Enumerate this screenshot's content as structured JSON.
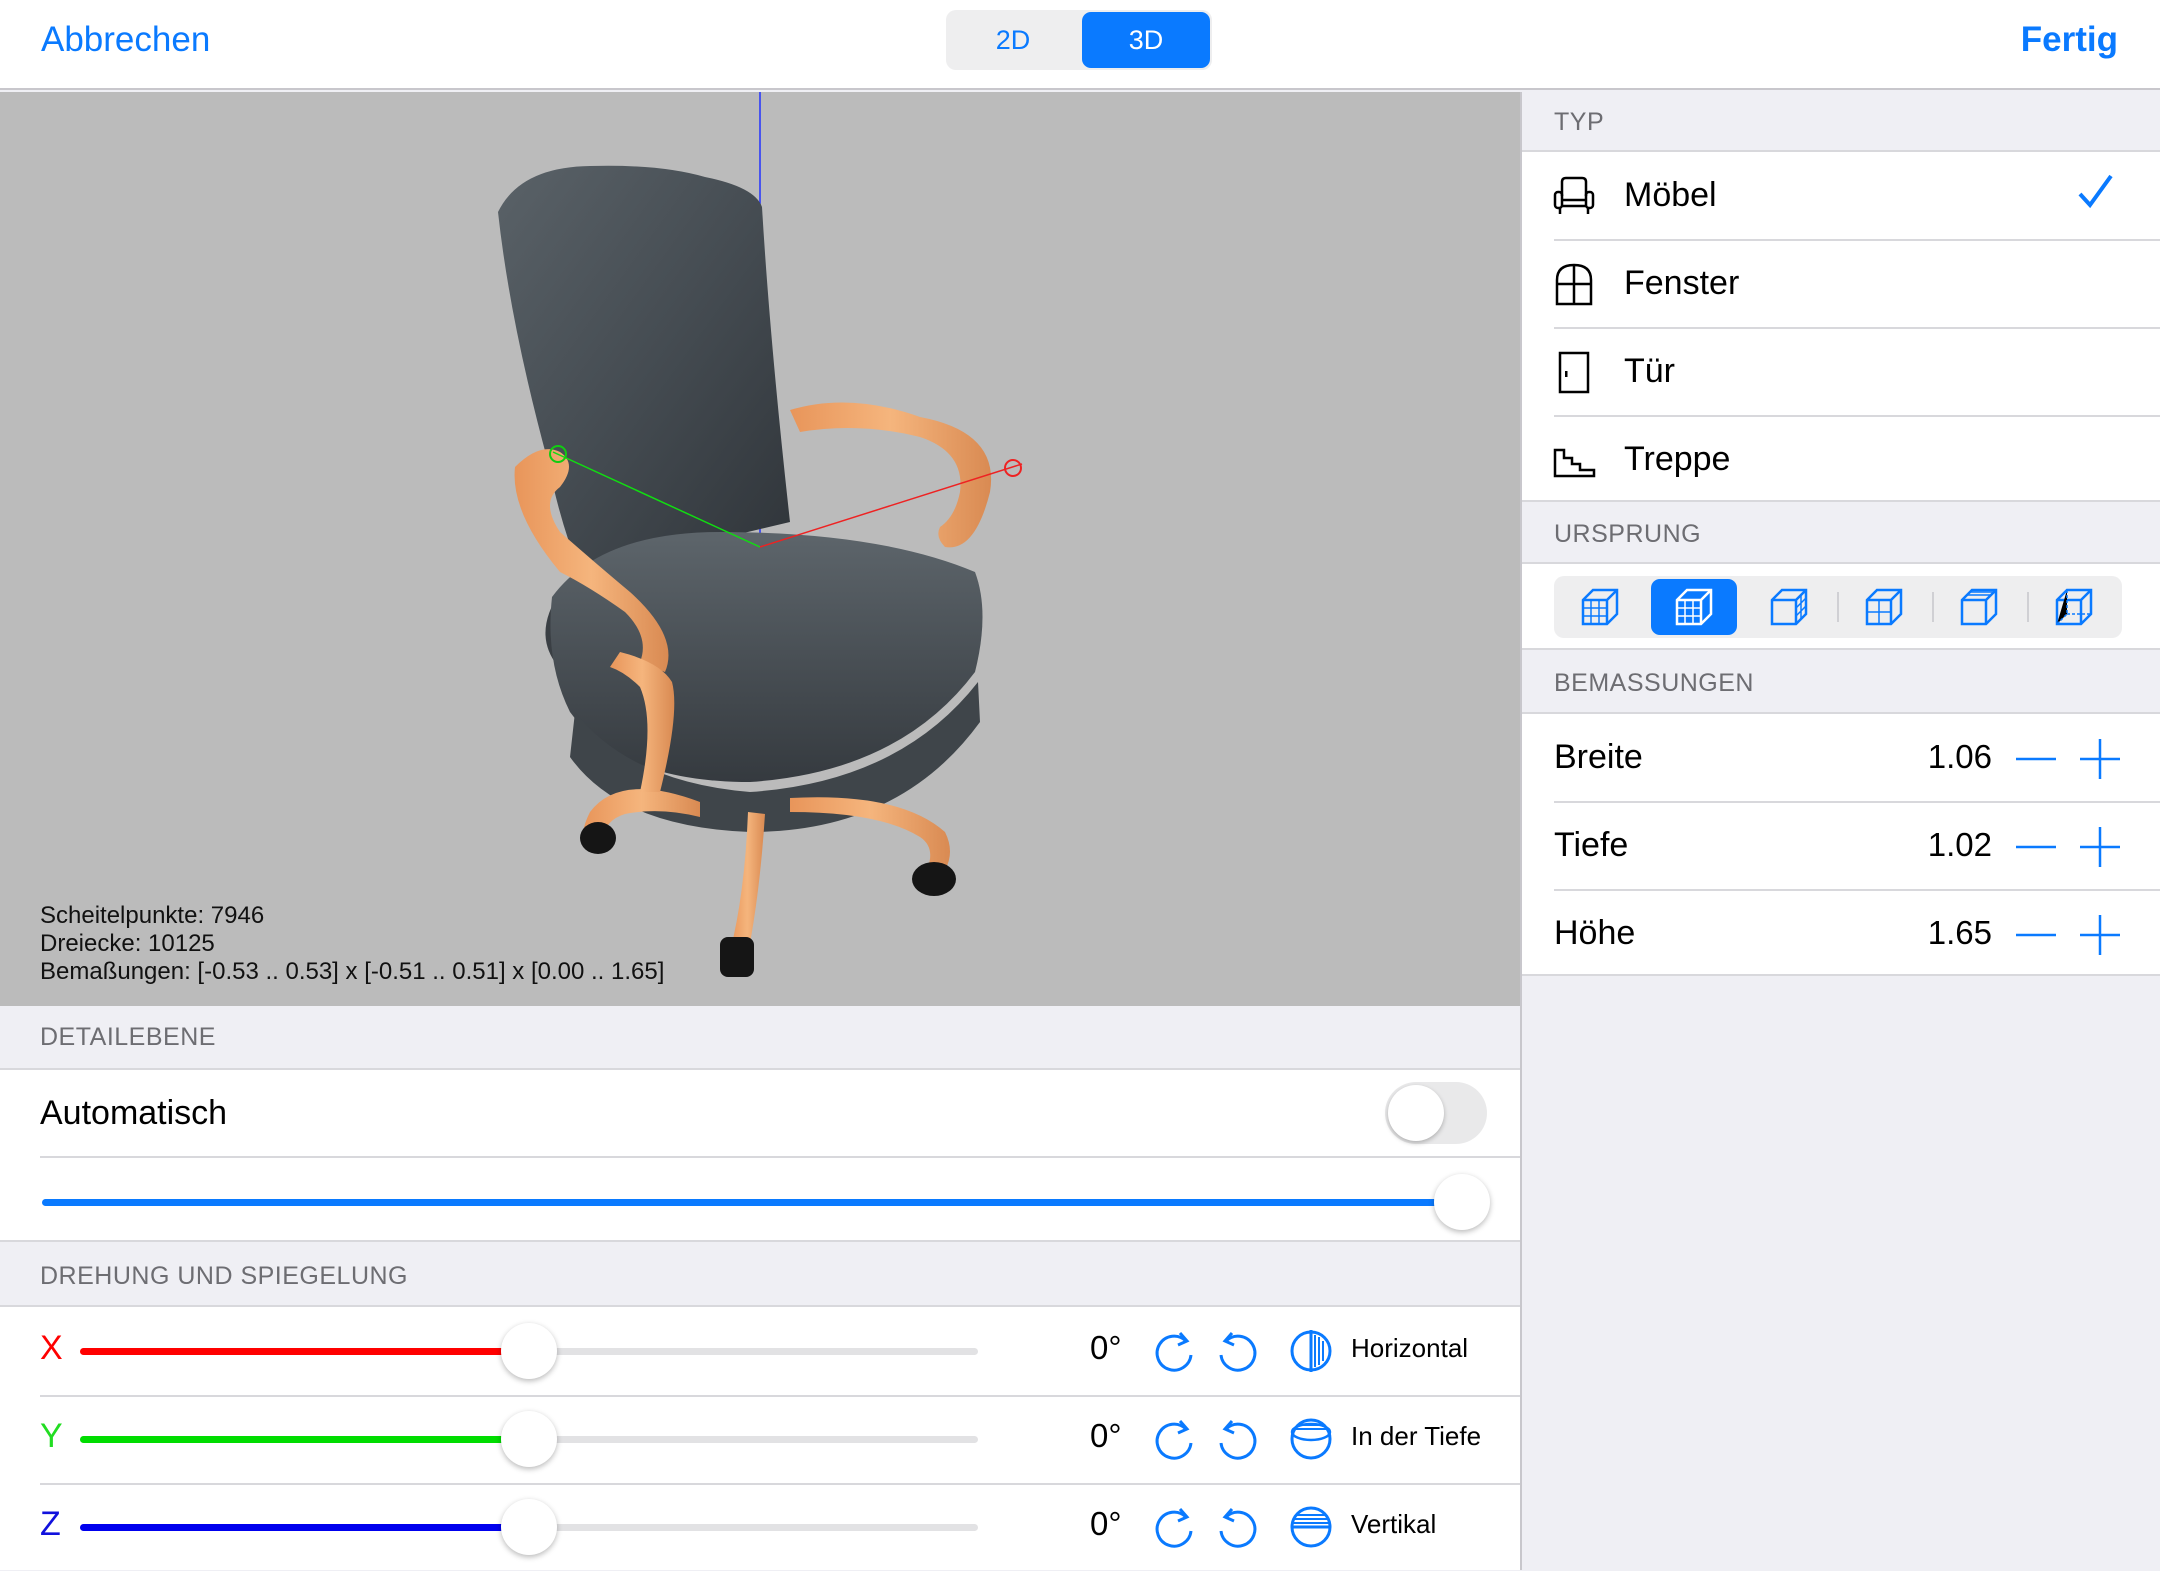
{
  "topbar": {
    "cancel_label": "Abbrechen",
    "done_label": "Fertig",
    "view_modes": [
      "2D",
      "3D"
    ],
    "selected_mode": "3D"
  },
  "viewport": {
    "stats": {
      "vertices": "Scheitelpunkte: 7946",
      "triangles": "Dreiecke: 10125",
      "dimensions": "Bemaßungen: [-0.53 .. 0.53] x [-0.51 .. 0.51] x [0.00 .. 1.65]"
    }
  },
  "detail": {
    "header": "DETAILEBENE",
    "auto_label": "Automatisch",
    "auto_enabled": false,
    "level": 1.0
  },
  "rotation": {
    "header": "DREHUNG UND SPIEGELUNG",
    "rows": [
      {
        "axis": "X",
        "color": "#ff0000",
        "value": "0°",
        "position": 0.5,
        "mirror_label": "Horizontal",
        "mirror_icon": "mirror-horizontal-icon"
      },
      {
        "axis": "Y",
        "color": "#00dd00",
        "value": "0°",
        "position": 0.5,
        "mirror_label": "In der Tiefe",
        "mirror_icon": "mirror-depth-icon"
      },
      {
        "axis": "Z",
        "color": "#0000ee",
        "value": "0°",
        "position": 0.5,
        "mirror_label": "Vertikal",
        "mirror_icon": "mirror-vertical-icon"
      }
    ]
  },
  "type": {
    "header": "TYP",
    "items": [
      {
        "label": "Möbel",
        "icon": "armchair-icon",
        "selected": true
      },
      {
        "label": "Fenster",
        "icon": "window-icon",
        "selected": false
      },
      {
        "label": "Tür",
        "icon": "door-icon",
        "selected": false
      },
      {
        "label": "Treppe",
        "icon": "stairs-icon",
        "selected": false
      }
    ]
  },
  "origin": {
    "header": "URSPRUNG",
    "options": 6,
    "selected_index": 1
  },
  "dimensions": {
    "header": "BEMASSUNGEN",
    "rows": [
      {
        "label": "Breite",
        "value": "1.06"
      },
      {
        "label": "Tiefe",
        "value": "1.02"
      },
      {
        "label": "Höhe",
        "value": "1.65"
      }
    ]
  },
  "colors": {
    "accent": "#0a7aff",
    "background": "#efeff4",
    "viewport": "#bbbbbb",
    "chair_leather": "#4a5258",
    "chair_wood": "#f0a868"
  }
}
